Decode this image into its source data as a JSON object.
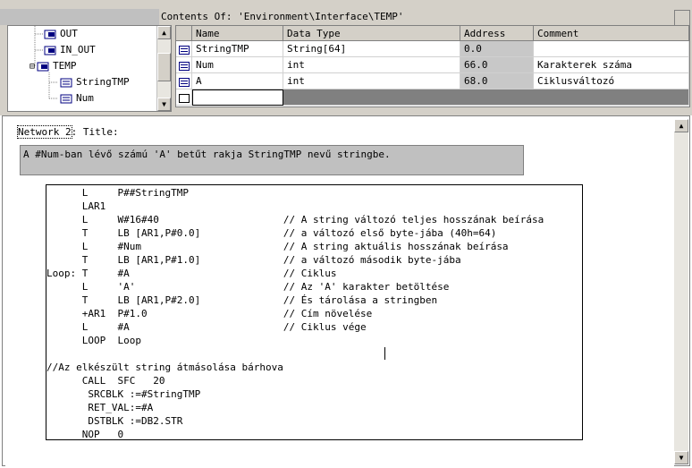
{
  "header": {
    "contents_title": "Contents Of: 'Environment\\Interface\\TEMP'"
  },
  "tree": {
    "items": [
      {
        "label": "OUT",
        "icon": "interface-param-icon"
      },
      {
        "label": "IN_OUT",
        "icon": "interface-param-icon"
      },
      {
        "label": "TEMP",
        "icon": "interface-param-icon",
        "expander": "⊟"
      },
      {
        "label": "StringTMP",
        "icon": "variable-icon"
      },
      {
        "label": "Num",
        "icon": "variable-icon"
      }
    ]
  },
  "table": {
    "columns": [
      "Name",
      "Data Type",
      "Address",
      "Comment"
    ],
    "rows": [
      {
        "name": "StringTMP",
        "type": "String[64]",
        "address": "0.0",
        "comment": ""
      },
      {
        "name": "Num",
        "type": "int",
        "address": "66.0",
        "comment": "Karakterek száma"
      },
      {
        "name": "A",
        "type": "int",
        "address": "68.0",
        "comment": "Ciklusváltozó"
      }
    ]
  },
  "network": {
    "label": "Network 2",
    "title_label": ": Title:",
    "comment": "A #Num-ban lévő számú 'A' betűt rakja StringTMP nevű stringbe."
  },
  "code": {
    "lines": [
      "      L     P##StringTMP",
      "      LAR1",
      "      L     W#16#40                     // A string változó teljes hosszának beírása",
      "      T     LB [AR1,P#0.0]              // a változó első byte-jába (40h=64)",
      "      L     #Num                        // A string aktuális hosszának beírása",
      "      T     LB [AR1,P#1.0]              // a változó második byte-jába",
      "Loop: T     #A                          // Ciklus",
      "      L     'A'                         // Az 'A' karakter betöltése",
      "      T     LB [AR1,P#2.0]              // És tárolása a stringben",
      "      +AR1  P#1.0                       // Cím növelése",
      "      L     #A                          // Ciklus vége",
      "      LOOP  Loop",
      "",
      "//Az elkészült string átmásolása bárhova",
      "      CALL  SFC   20",
      "       SRCBLK :=#StringTMP",
      "       RET_VAL:=#A",
      "       DSTBLK :=DB2.STR",
      "      NOP   0"
    ]
  }
}
